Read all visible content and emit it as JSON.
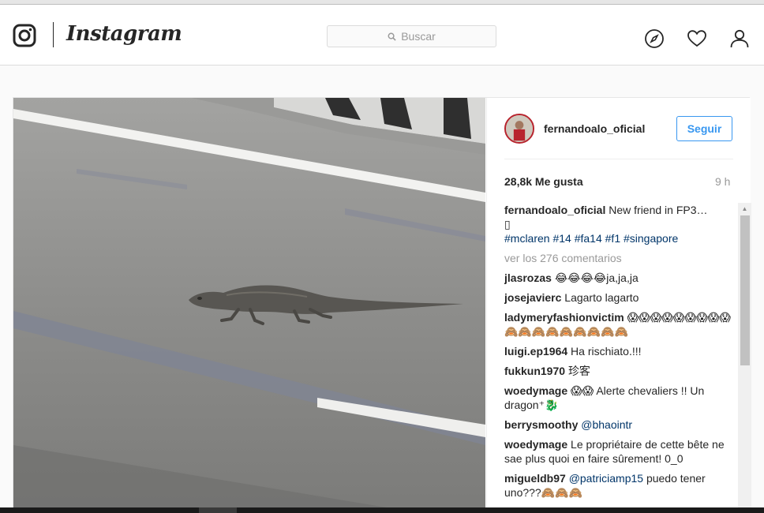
{
  "navbar": {
    "logo_icon": "instagram-camera-icon",
    "wordmark": "Instagram",
    "search_placeholder": "Buscar",
    "icons": [
      "compass-icon",
      "heart-icon",
      "profile-icon"
    ]
  },
  "post": {
    "username": "fernandoalo_oficial",
    "follow_label": "Seguir",
    "likes": "28,8k Me gusta",
    "time": "9 h",
    "caption": {
      "user": "fernandoalo_oficial",
      "text": "New friend in FP3…",
      "glyph": "▯",
      "hashtags": "#mclaren #14 #fa14 #f1 #singapore"
    },
    "view_all": "ver los 276 comentarios",
    "comments": [
      {
        "user": "jlasrozas",
        "text": "😂😂😂😂ja,ja,ja"
      },
      {
        "user": "josejavierc",
        "text": "Lagarto lagarto"
      },
      {
        "user": "ladymeryfashionvictim",
        "text": "😱😱😱😱😱😱😱😱😱🙈🙈🙈🙈🙈🙈🙈🙈🙈"
      },
      {
        "user": "luigi.ep1964",
        "text": "Ha rischiato.!!!"
      },
      {
        "user": "fukkun1970",
        "text": "珍客"
      },
      {
        "user": "woedymage",
        "text": "😱😱 Alerte chevaliers !! Un dragon⁺🐉"
      },
      {
        "user": "berrysmoothy",
        "mention": "@bhaointr",
        "text": ""
      },
      {
        "user": "woedymage",
        "text": "Le propriétaire de cette bête ne sae plus quoi en faire sûrement! 0_0"
      },
      {
        "user": "migueldb97",
        "mention": "@patriciamp15",
        "text": "puedo tener uno???🙈🙈🙈"
      }
    ]
  },
  "colors": {
    "accent": "#3897f0",
    "avatar_ring": "#b8232d",
    "hashtag": "#003569",
    "muted": "#999999"
  }
}
